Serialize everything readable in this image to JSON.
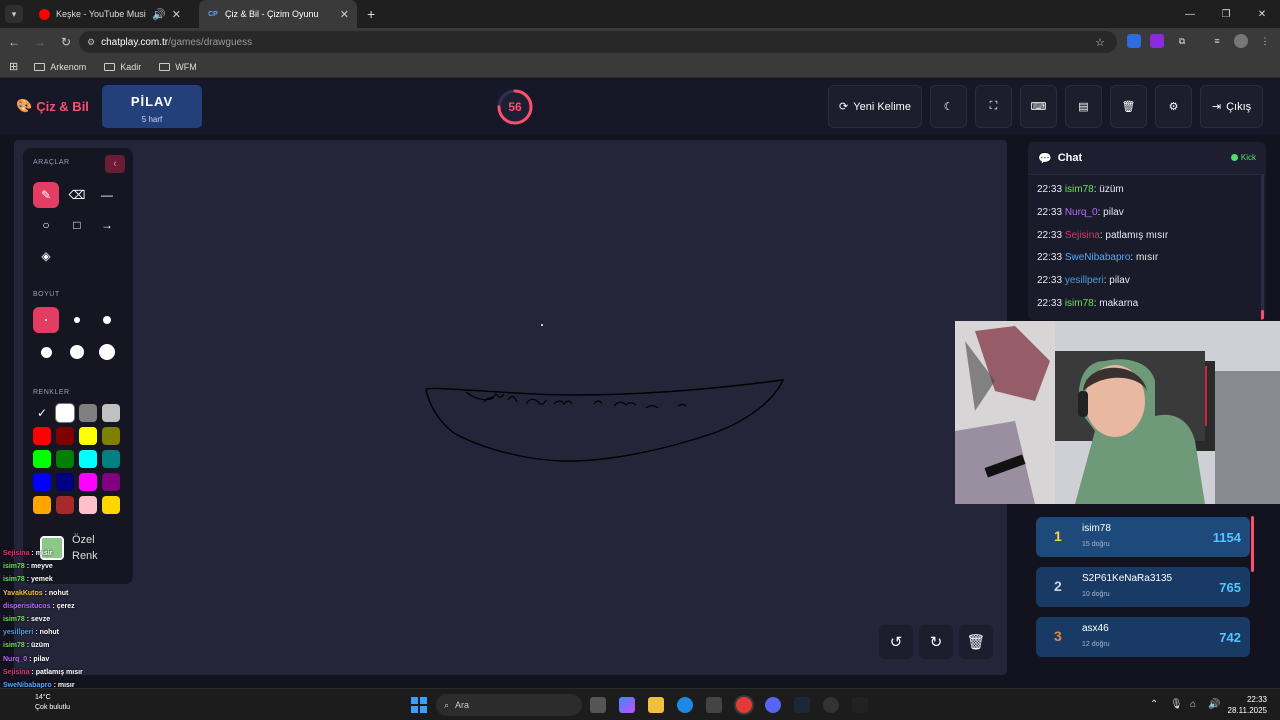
{
  "browser": {
    "tabs": [
      {
        "title": "Keşke - YouTube Music",
        "favicon": "youtube-music-icon",
        "audio": true
      },
      {
        "title": "Çiz & Bil - Çizim Oyunu",
        "favicon": "chatplay-icon",
        "active": true
      }
    ],
    "url_host": "chatplay.com.tr",
    "url_path": "/games/drawguess",
    "bookmarks": [
      "Arkenom",
      "Kadir",
      "WFM"
    ]
  },
  "app": {
    "logo": "Çiz & Bil",
    "word": "PİLAV",
    "word_hint": "5 harf",
    "timer": "56",
    "timer_fraction": 0.75,
    "header_buttons": {
      "new_word": "Yeni Kelime",
      "exit": "Çıkış"
    }
  },
  "tools": {
    "tools_label": "ARAÇLAR",
    "size_label": "BOYUT",
    "colors_label": "RENKLER",
    "custom_label_1": "Özel",
    "custom_label_2": "Renk",
    "custom_color": "#8cc887",
    "palette": [
      "#000000",
      "#ffffff",
      "#808080",
      "#c0c0c0",
      "#ff0000",
      "#800000",
      "#ffff00",
      "#808000",
      "#00ff00",
      "#008000",
      "#00ffff",
      "#008080",
      "#0000ff",
      "#000080",
      "#ff00ff",
      "#800080",
      "#ffa500",
      "#a52a2a",
      "#ffc0cb",
      "#ffd700"
    ]
  },
  "chat": {
    "title": "Chat",
    "platform": "Kick",
    "messages": [
      {
        "time": "22:33",
        "user": "isim78",
        "color": "#6ee05a",
        "text": ": üzüm"
      },
      {
        "time": "22:33",
        "user": "Nurq_0",
        "color": "#b36bff",
        "text": ": pilav"
      },
      {
        "time": "22:33",
        "user": "Sejisina",
        "color": "#e0306a",
        "text": ": patlamış mısır"
      },
      {
        "time": "22:33",
        "user": "SweNibabapro",
        "color": "#4fa8ff",
        "text": ": mısır"
      },
      {
        "time": "22:33",
        "user": "yesillperi",
        "color": "#4f9fe0",
        "text": ": pilav"
      },
      {
        "time": "22:33",
        "user": "isim78",
        "color": "#6ee05a",
        "text": ": makarna"
      }
    ]
  },
  "leaderboard": [
    {
      "rank": "1",
      "name": "isim78",
      "sub": "15 doğru",
      "score": "1154",
      "rank_color": "#ffd23f"
    },
    {
      "rank": "2",
      "name": "S2P61KeNaRa3135",
      "sub": "10 doğru",
      "score": "765",
      "rank_color": "#c9d2e0"
    },
    {
      "rank": "3",
      "name": "asx46",
      "sub": "12 doğru",
      "score": "742",
      "rank_color": "#e0883a"
    }
  ],
  "overlay_chat": [
    {
      "user": "Sejisina",
      "color": "#e0306a",
      "text": " : misir"
    },
    {
      "user": "isim78",
      "color": "#6ee05a",
      "text": " : meyve"
    },
    {
      "user": "isim78",
      "color": "#6ee05a",
      "text": " : yemek"
    },
    {
      "user": "YavakKutos",
      "color": "#f0c040",
      "text": " : nohut"
    },
    {
      "user": "disperisitucos",
      "color": "#b36bff",
      "text": " : çerez"
    },
    {
      "user": "isim78",
      "color": "#6ee05a",
      "text": " : sevze"
    },
    {
      "user": "yesillperi",
      "color": "#4f9fe0",
      "text": " : nohut"
    },
    {
      "user": "isim78",
      "color": "#6ee05a",
      "text": " : üzüm"
    },
    {
      "user": "Nurq_0",
      "color": "#b36bff",
      "text": " : pilav"
    },
    {
      "user": "Sejisina",
      "color": "#e0306a",
      "text": " : patlamış mısır"
    },
    {
      "user": "SweNibabapro",
      "color": "#4fa8ff",
      "text": " : mısır"
    },
    {
      "user": "yesillperi",
      "color": "#4f9fe0",
      "text": " : pilav"
    },
    {
      "user": "isim78",
      "color": "#6ee05a",
      "text": " : makarna"
    }
  ],
  "weather": {
    "temp": "14°C",
    "desc": "Çok bulutlu"
  },
  "taskbar": {
    "search": "Ara",
    "time": "22:33",
    "date": "28.11.2025"
  }
}
